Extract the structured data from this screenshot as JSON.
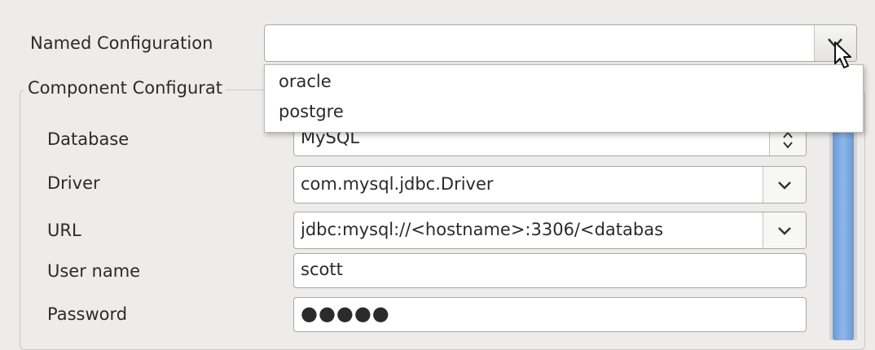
{
  "named_configuration": {
    "label": "Named Configuration",
    "value": "",
    "options": [
      "oracle",
      "postgre"
    ]
  },
  "component_configuration": {
    "title": "Component Configurat",
    "database": {
      "label": "Database",
      "value": "MySQL"
    },
    "driver": {
      "label": "Driver",
      "value": "com.mysql.jdbc.Driver"
    },
    "url": {
      "label": "URL",
      "value": "jdbc:mysql://<hostname>:3306/<databas"
    },
    "username": {
      "label": "User name",
      "value": "scott"
    },
    "password": {
      "label": "Password",
      "value": "●●●●●"
    }
  },
  "icons": {
    "combo_arrow": "chevron-down-icon",
    "spin": "up-down-arrows-icon",
    "cursor": "mouse-pointer-icon"
  },
  "colors": {
    "window_bg": "#edecea",
    "scroll_thumb": "#7aa7df"
  }
}
